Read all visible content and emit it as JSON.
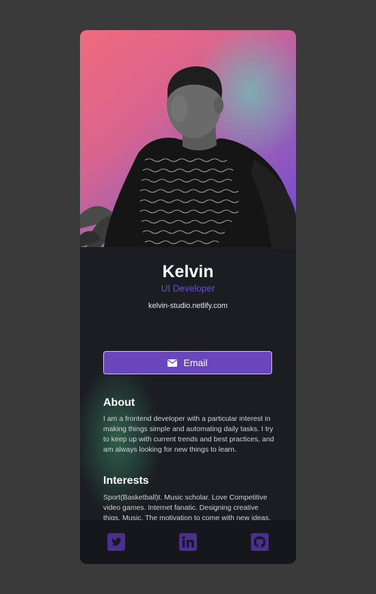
{
  "profile": {
    "name": "Kelvin",
    "role": "UI Developer",
    "website": "kelvin-studio.netlify.com"
  },
  "actions": {
    "email_label": "Email",
    "email_icon": "envelope-icon"
  },
  "about": {
    "title": "About",
    "text": "I am a frontend developer with a particular interest in making things simple and automating daily tasks. I try to keep up with current trends and best practices, and am always looking for new things to learn."
  },
  "interests": {
    "title": "Interests",
    "text": "Sport(Basketball)t. Music scholar. Love Competitive video games. Internet fanatic. Designing creative thigs. Music. The motivation to come with new ideas."
  },
  "social": [
    {
      "icon": "twitter-icon"
    },
    {
      "icon": "linkedin-icon"
    },
    {
      "icon": "github-icon"
    }
  ],
  "colors": {
    "page_background": "#3a3a3a",
    "card_background": "#1b1d22",
    "accent": "#6a46bd",
    "role_text": "#6b4fc7",
    "footer_background": "#16171b",
    "social_icon": "#4a2f8f"
  }
}
